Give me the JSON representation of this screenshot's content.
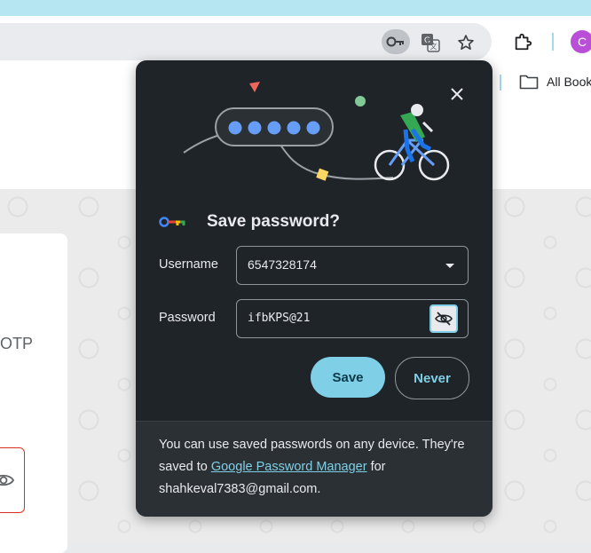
{
  "browser": {
    "avatar_letter": "C",
    "bookmarks_folder_label": "All Book",
    "icons": [
      "password-key-icon",
      "translate-icon",
      "star-icon",
      "extensions-icon",
      "folder-icon"
    ]
  },
  "page": {
    "partial_text": "OTP"
  },
  "popup": {
    "title": "Save password?",
    "username_label": "Username",
    "username_value": "6547328174",
    "password_label": "Password",
    "password_value": "ifbKPS@21",
    "save_label": "Save",
    "never_label": "Never",
    "footer_text_1": "You can use saved passwords on any device. They're saved to ",
    "footer_link": "Google Password Manager",
    "footer_text_2": " for",
    "footer_email": "shahkeval7383@gmail.com."
  },
  "colors": {
    "popup_bg": "#1f2428",
    "accent": "#7fcfe6",
    "footer_bg": "#2a3034"
  }
}
